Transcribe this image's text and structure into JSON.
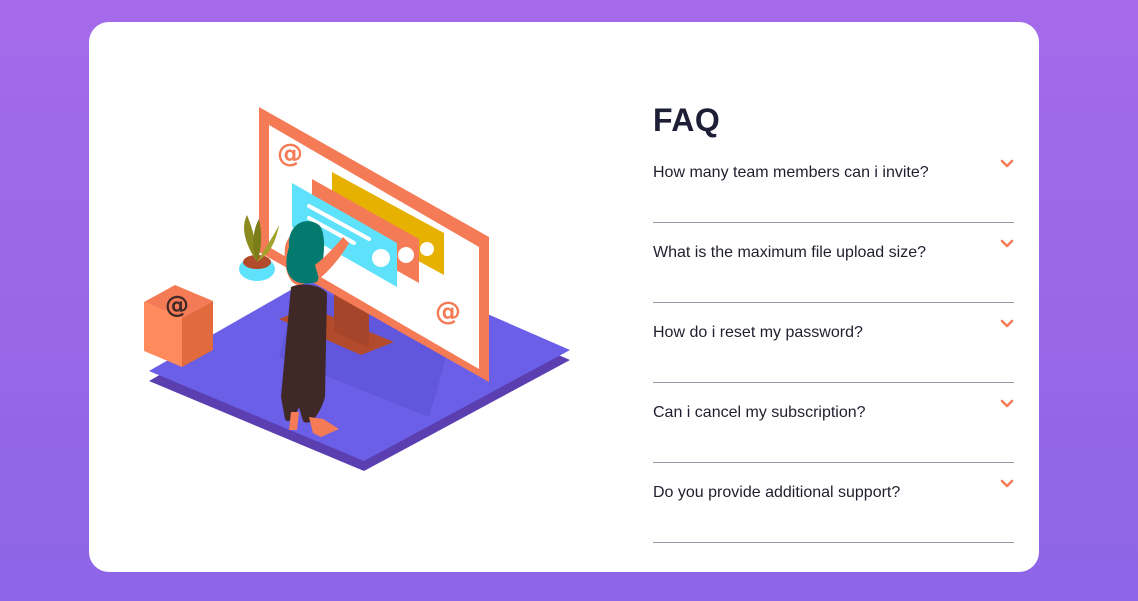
{
  "faq": {
    "title": "FAQ",
    "items": [
      {
        "question": "How many team members can i invite?"
      },
      {
        "question": "What is the maximum file upload size?"
      },
      {
        "question": "How do i reset my password?"
      },
      {
        "question": "Can i cancel my subscription?"
      },
      {
        "question": "Do you provide additional support?"
      }
    ]
  },
  "icons": {
    "item_toggle": "chevron-down-icon"
  },
  "colors": {
    "background_top": "#a56aea",
    "background_bottom": "#8d65e6",
    "card": "#ffffff",
    "accent": "#f47b56",
    "divider": "#9a9aa6",
    "text": "#1f1f2e"
  }
}
